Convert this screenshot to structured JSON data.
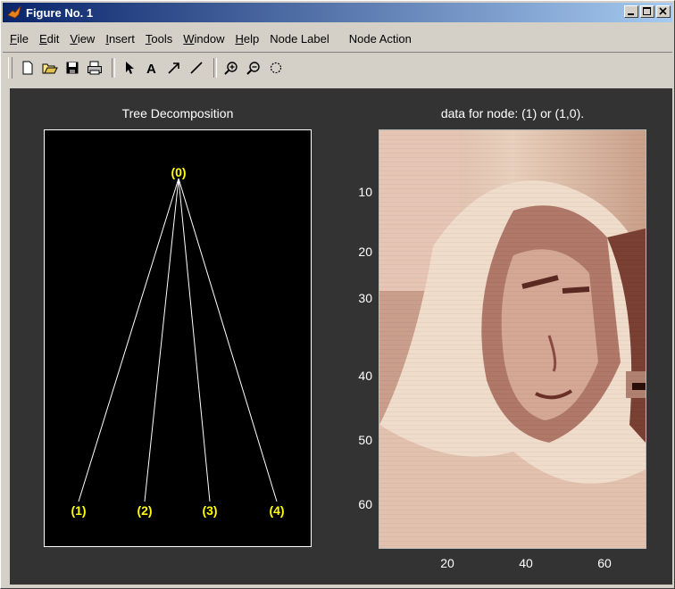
{
  "window": {
    "title": "Figure No. 1"
  },
  "menu": [
    {
      "label": "File",
      "key": "F",
      "rest": "ile"
    },
    {
      "label": "Edit",
      "key": "E",
      "rest": "dit"
    },
    {
      "label": "View",
      "key": "V",
      "rest": "iew"
    },
    {
      "label": "Insert",
      "key": "I",
      "rest": "nsert"
    },
    {
      "label": "Tools",
      "key": "T",
      "rest": "ools"
    },
    {
      "label": "Window",
      "key": "W",
      "rest": "indow"
    },
    {
      "label": "Help",
      "key": "H",
      "rest": "elp"
    },
    {
      "label": "Node Label",
      "key": "",
      "rest": "Node Label"
    },
    {
      "label": "Node Action",
      "key": "",
      "rest": "Node Action"
    }
  ],
  "toolbar": [
    "new-file-icon",
    "open-folder-icon",
    "save-icon",
    "print-icon",
    "pointer-icon",
    "text-icon",
    "arrow-icon",
    "line-icon",
    "zoom-in-icon",
    "zoom-out-icon",
    "rotate-icon"
  ],
  "tree": {
    "title": "Tree Decomposition",
    "root": "(0)",
    "children": [
      "(1)",
      "(2)",
      "(3)",
      "(4)"
    ],
    "label_color": "#ffff00",
    "edge_color": "#ffffff"
  },
  "image_panel": {
    "title": "data for node: (1) or (1,0).",
    "yticks": [
      "10",
      "20",
      "30",
      "40",
      "50",
      "60"
    ],
    "xticks": [
      "20",
      "40",
      "60"
    ]
  },
  "colors": {
    "figure_bg": "#333333",
    "axes_bg": "#000000",
    "title_start": "#0a246a",
    "title_end": "#a6caf0"
  }
}
